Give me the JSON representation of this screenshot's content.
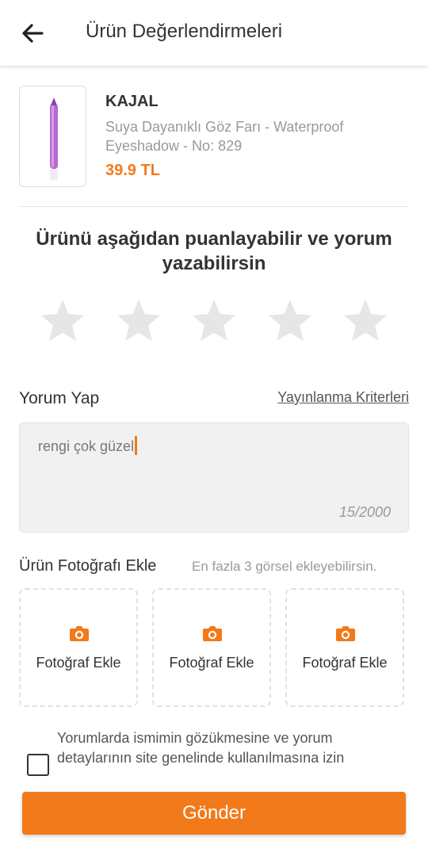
{
  "header": {
    "title": "Ürün Değerlendirmeleri",
    "back_icon": "arrow-left-icon"
  },
  "product": {
    "brand": "KAJAL",
    "name": "Suya Dayanıklı Göz Farı - Waterproof Eyeshadow - No: 829",
    "price": "39.9 TL"
  },
  "rating": {
    "title": "Ürünü aşağıdan puanlayabilir ve yorum yazabilirsin",
    "selected": 0,
    "max": 5
  },
  "comment": {
    "label": "Yorum Yap",
    "criteria_link": "Yayınlanma Kriterleri",
    "value": "rengi çok güzel",
    "counter": "15/2000"
  },
  "photos": {
    "label": "Ürün Fotoğrafı Ekle",
    "hint": "En fazla 3 görsel ekleyebilirsin.",
    "slots": [
      {
        "label": "Fotoğraf Ekle",
        "icon": "camera-icon"
      },
      {
        "label": "Fotoğraf Ekle",
        "icon": "camera-icon"
      },
      {
        "label": "Fotoğraf Ekle",
        "icon": "camera-icon"
      }
    ]
  },
  "consent": {
    "text": "Yorumlarda ismimin gözükmesine ve yorum detaylarının site genelinde kullanılmasına izin",
    "checked": false
  },
  "submit": {
    "label": "Gönder"
  },
  "colors": {
    "accent": "#f27a1a",
    "star_empty": "#e6e6e6",
    "text_dark": "#333333",
    "text_muted": "#999999"
  }
}
